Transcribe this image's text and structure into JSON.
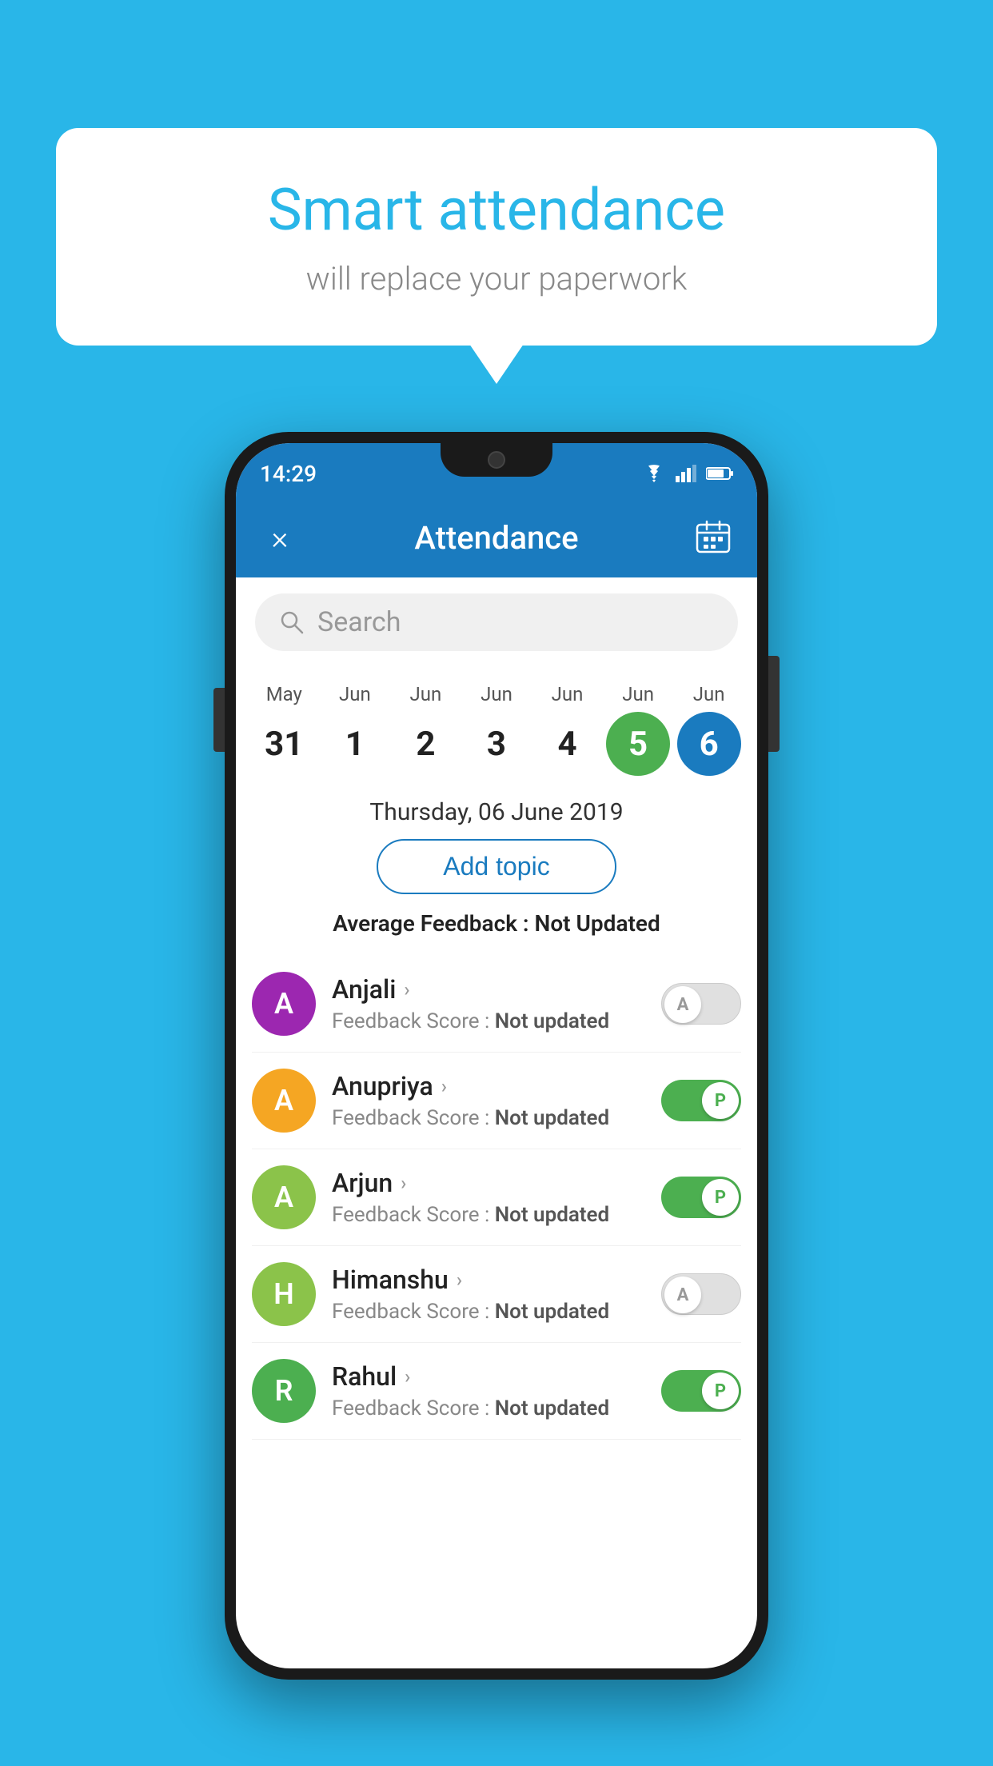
{
  "background": {
    "color": "#29b6e8"
  },
  "speech_bubble": {
    "title": "Smart attendance",
    "subtitle": "will replace your paperwork"
  },
  "phone": {
    "status_bar": {
      "time": "14:29"
    },
    "app_bar": {
      "title": "Attendance",
      "close_icon": "×",
      "calendar_icon": "📅"
    },
    "search": {
      "placeholder": "Search"
    },
    "calendar": {
      "days": [
        {
          "month": "May",
          "date": "31",
          "style": "normal"
        },
        {
          "month": "Jun",
          "date": "1",
          "style": "normal"
        },
        {
          "month": "Jun",
          "date": "2",
          "style": "normal"
        },
        {
          "month": "Jun",
          "date": "3",
          "style": "normal"
        },
        {
          "month": "Jun",
          "date": "4",
          "style": "normal"
        },
        {
          "month": "Jun",
          "date": "5",
          "style": "green"
        },
        {
          "month": "Jun",
          "date": "6",
          "style": "blue"
        }
      ],
      "selected_date": "Thursday, 06 June 2019"
    },
    "add_topic_label": "Add topic",
    "avg_feedback_label": "Average Feedback :",
    "avg_feedback_value": "Not Updated",
    "students": [
      {
        "name": "Anjali",
        "avatar_letter": "A",
        "avatar_color": "#9c27b0",
        "feedback_label": "Feedback Score :",
        "feedback_value": "Not updated",
        "toggle_state": "off",
        "toggle_letter": "A"
      },
      {
        "name": "Anupriya",
        "avatar_letter": "A",
        "avatar_color": "#f5a623",
        "feedback_label": "Feedback Score :",
        "feedback_value": "Not updated",
        "toggle_state": "on",
        "toggle_letter": "P"
      },
      {
        "name": "Arjun",
        "avatar_letter": "A",
        "avatar_color": "#8bc34a",
        "feedback_label": "Feedback Score :",
        "feedback_value": "Not updated",
        "toggle_state": "on",
        "toggle_letter": "P"
      },
      {
        "name": "Himanshu",
        "avatar_letter": "H",
        "avatar_color": "#8bc34a",
        "feedback_label": "Feedback Score :",
        "feedback_value": "Not updated",
        "toggle_state": "off",
        "toggle_letter": "A"
      },
      {
        "name": "Rahul",
        "avatar_letter": "R",
        "avatar_color": "#4caf50",
        "feedback_label": "Feedback Score :",
        "feedback_value": "Not updated",
        "toggle_state": "on",
        "toggle_letter": "P"
      }
    ]
  }
}
